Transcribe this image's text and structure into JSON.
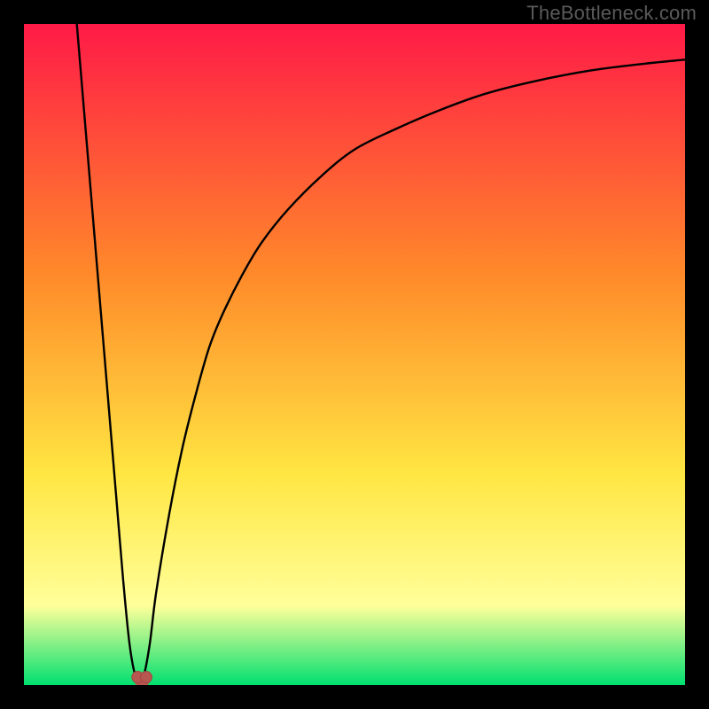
{
  "watermark": "TheBottleneck.com",
  "colors": {
    "background": "#000000",
    "gradient_top": "#ff1a47",
    "gradient_mid_orange": "#ff8a2a",
    "gradient_mid_yellow": "#ffe642",
    "gradient_pale_yellow": "#ffff9a",
    "gradient_green": "#00e070",
    "curve": "#000000",
    "marker_fill": "#b85650",
    "marker_stroke": "#a04840"
  },
  "chart_data": {
    "type": "line",
    "title": "",
    "xlabel": "",
    "ylabel": "",
    "xlim": [
      0,
      100
    ],
    "ylim": [
      0,
      100
    ],
    "series": [
      {
        "name": "bottleneck-curve",
        "x": [
          8,
          9,
          10,
          11,
          12,
          13,
          14,
          15,
          16,
          17,
          18,
          19,
          20,
          22,
          24,
          26,
          28,
          30,
          33,
          36,
          40,
          45,
          50,
          56,
          63,
          70,
          78,
          86,
          94,
          100
        ],
        "values": [
          100,
          88,
          76,
          64,
          52,
          40,
          28,
          16,
          6,
          1,
          1,
          6,
          14,
          26,
          36,
          44,
          51,
          56,
          62,
          67,
          72,
          77,
          81,
          84,
          87,
          89.5,
          91.5,
          93,
          94,
          94.6
        ]
      }
    ],
    "markers": [
      {
        "name": "minimum-left",
        "x": 17.2,
        "y": 1.2
      },
      {
        "name": "minimum-right",
        "x": 18.5,
        "y": 1.2
      }
    ],
    "annotations": []
  }
}
